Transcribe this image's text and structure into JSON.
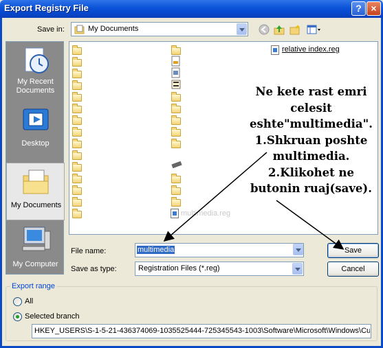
{
  "window": {
    "title": "Export Registry File",
    "help": "?",
    "close": "×"
  },
  "toolbar": {
    "save_in_label": "Save in:",
    "location": "My Documents",
    "icons": [
      "back-icon",
      "up-folder-icon",
      "new-folder-icon",
      "view-menu-icon"
    ]
  },
  "places": [
    {
      "label": "My Recent Documents",
      "icon": "recent-documents-icon"
    },
    {
      "label": "Desktop",
      "icon": "desktop-icon"
    },
    {
      "label": "My Documents",
      "icon": "my-documents-icon",
      "selected": true
    },
    {
      "label": "My Computer",
      "icon": "my-computer-icon"
    }
  ],
  "files": {
    "reg_name": "relative index.reg",
    "ghost_name": "multimedia.reg"
  },
  "annotation": {
    "lines": [
      "Ne kete rast emri",
      "celesit",
      "eshte\"multimedia\".",
      "1.Shkruan poshte",
      "multimedia.",
      "2.Klikohet ne",
      "butonin ruaj(save)."
    ]
  },
  "filename": {
    "label": "File name:",
    "value": "multimedia"
  },
  "savetype": {
    "label": "Save as type:",
    "value": "Registration Files (*.reg)"
  },
  "buttons": {
    "save": "Save",
    "cancel": "Cancel"
  },
  "export_range": {
    "title": "Export range",
    "all": "All",
    "selected_branch": "Selected branch",
    "selected": "selected_branch",
    "branch_path": "HKEY_USERS\\S-1-5-21-436374069-1035525444-725345543-1003\\Software\\Microsoft\\Windows\\Cur"
  }
}
